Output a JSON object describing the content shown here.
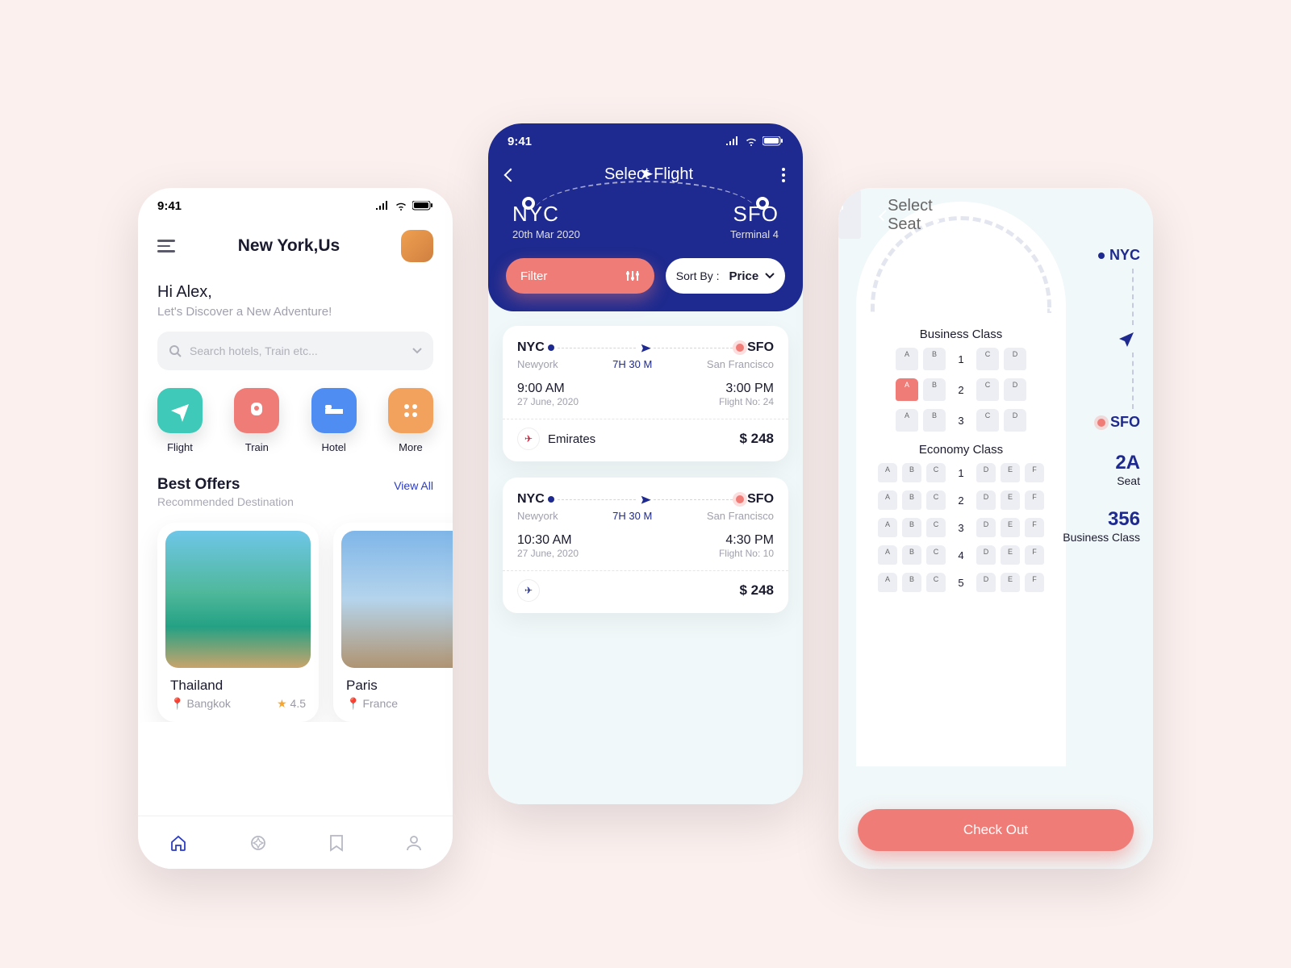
{
  "status": {
    "time": "9:41"
  },
  "home": {
    "location": "New York,Us",
    "greeting": "Hi Alex,",
    "subgreeting": "Let's Discover a New Adventure!",
    "search_placeholder": "Search hotels, Train etc...",
    "categories": [
      {
        "label": "Flight"
      },
      {
        "label": "Train"
      },
      {
        "label": "Hotel"
      },
      {
        "label": "More"
      }
    ],
    "offers": {
      "title": "Best Offers",
      "subtitle": "Recommended Destination",
      "view_all": "View All",
      "items": [
        {
          "name": "Thailand",
          "city": "Bangkok",
          "rating": "4.5"
        },
        {
          "name": "Paris",
          "city": "France",
          "rating": ""
        }
      ]
    }
  },
  "flights": {
    "title": "Select Flight",
    "origin": {
      "code": "NYC",
      "sub": "20th Mar 2020"
    },
    "dest": {
      "code": "SFO",
      "sub": "Terminal 4"
    },
    "filter_label": "Filter",
    "sort_label": "Sort By :",
    "sort_value": "Price",
    "list": [
      {
        "from_code": "NYC",
        "from_city": "Newyork",
        "to_code": "SFO",
        "to_city": "San Francisco",
        "duration": "7H 30 M",
        "dep_time": "9:00 AM",
        "dep_date": "27 June, 2020",
        "arr_time": "3:00 PM",
        "arr_sub": "Flight No: 24",
        "airline": "Emirates",
        "price": "$ 248"
      },
      {
        "from_code": "NYC",
        "from_city": "Newyork",
        "to_code": "SFO",
        "to_city": "San Francisco",
        "duration": "7H 30 M",
        "dep_time": "10:30 AM",
        "dep_date": "27 June, 2020",
        "arr_time": "4:30 PM",
        "arr_sub": "Flight No: 10",
        "airline": "",
        "price": "$ 248"
      }
    ]
  },
  "seats": {
    "title": "Select Seat",
    "business_label": "Business  Class",
    "economy_label": "Economy Class",
    "origin": "NYC",
    "dest": "SFO",
    "selected_seat": "2A",
    "seat_label": "Seat",
    "price": "356",
    "class_label": "Business Class",
    "checkout": "Check Out",
    "biz_rows": [
      {
        "n": "1",
        "seats": [
          "A",
          "B",
          "C",
          "D"
        ]
      },
      {
        "n": "2",
        "seats": [
          "A",
          "B",
          "C",
          "D"
        ]
      },
      {
        "n": "3",
        "seats": [
          "A",
          "B",
          "C",
          "D"
        ]
      }
    ],
    "eco_rows": [
      {
        "n": "1",
        "seats": [
          "A",
          "B",
          "C",
          "D",
          "E",
          "F"
        ]
      },
      {
        "n": "2",
        "seats": [
          "A",
          "B",
          "C",
          "D",
          "E",
          "F"
        ]
      },
      {
        "n": "3",
        "seats": [
          "A",
          "B",
          "C",
          "D",
          "E",
          "F"
        ]
      },
      {
        "n": "4",
        "seats": [
          "A",
          "B",
          "C",
          "D",
          "E",
          "F"
        ]
      },
      {
        "n": "5",
        "seats": [
          "A",
          "B",
          "C",
          "D",
          "E",
          "F"
        ]
      }
    ]
  }
}
